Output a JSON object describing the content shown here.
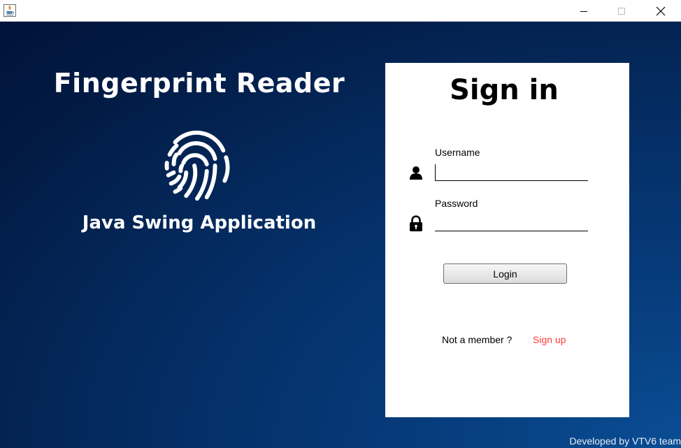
{
  "window": {
    "title": "",
    "icon": "java-icon",
    "controls": [
      "minimize-icon",
      "maximize-icon",
      "close-icon"
    ]
  },
  "branding": {
    "title": "Fingerprint Reader",
    "icon": "fingerprint-icon",
    "subtitle": "Java Swing Application",
    "credit": "Developed by VTV6 team"
  },
  "signin": {
    "title": "Sign in",
    "username_label": "Username",
    "username_value": "",
    "username_icon": "user-icon",
    "password_label": "Password",
    "password_value": "",
    "password_icon": "lock-icon",
    "login_label": "Login",
    "not_member_text": "Not a member ?",
    "signup_label": "Sign up"
  },
  "colors": {
    "background_dark": "#01133a",
    "background_light": "#0a4d94",
    "signup_link": "#ff3b3b"
  }
}
